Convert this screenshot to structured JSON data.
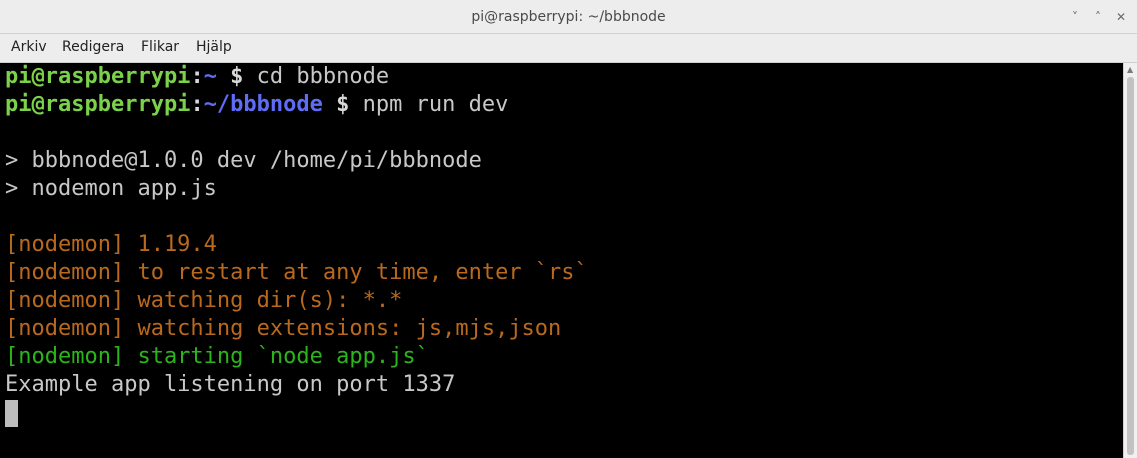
{
  "window": {
    "title": "pi@raspberrypi: ~/bbbnode"
  },
  "window_buttons": {
    "minimize": "˅",
    "maximize": "˄",
    "close": "✕"
  },
  "menu": {
    "items": [
      "Arkiv",
      "Redigera",
      "Flikar",
      "Hjälp"
    ]
  },
  "terminal": {
    "line1": {
      "user": "pi@raspberrypi",
      "colon": ":",
      "path": "~",
      "prompt": " $",
      "cmd": " cd bbbnode"
    },
    "line2": {
      "user": "pi@raspberrypi",
      "colon": ":",
      "path": "~/bbbnode",
      "prompt": " $",
      "cmd": " npm run dev"
    },
    "output": [
      "> bbbnode@1.0.0 dev /home/pi/bbbnode",
      "> nodemon app.js",
      "[nodemon] 1.19.4",
      "[nodemon] to restart at any time, enter `rs`",
      "[nodemon] watching dir(s): *.*",
      "[nodemon] watching extensions: js,mjs,json",
      "[nodemon] starting `node app.js`",
      "Example app listening on port 1337"
    ]
  },
  "colors": {
    "user": "#7bd24a",
    "path": "#5f6cf6",
    "nodemon_info": "#b8691d",
    "nodemon_start": "#2bb51a",
    "text": "#c8c8c8"
  }
}
